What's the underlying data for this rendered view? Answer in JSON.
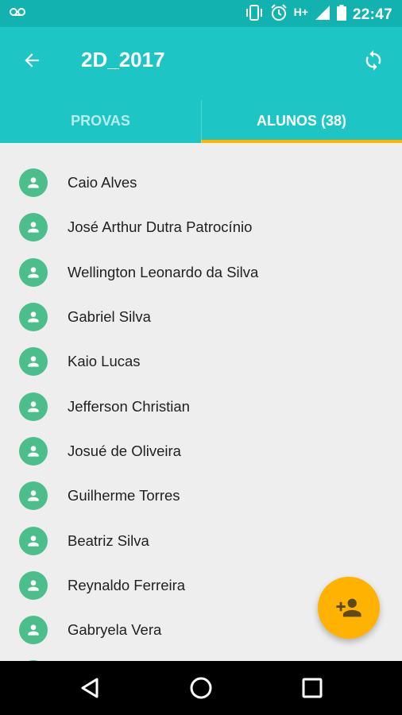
{
  "status_bar": {
    "time": "22:47",
    "network": "H+",
    "icons": [
      "voicemail-icon",
      "vibrate-icon",
      "alarm-icon",
      "signal-icon",
      "battery-icon"
    ]
  },
  "app_bar": {
    "title": "2D_2017",
    "back_icon": "arrow-back-icon",
    "sync_icon": "sync-icon"
  },
  "tabs": [
    {
      "label": "PROVAS",
      "active": false
    },
    {
      "label": "ALUNOS (38)",
      "active": true
    }
  ],
  "students": [
    {
      "name": "Caio Alves"
    },
    {
      "name": "José Arthur Dutra Patrocínio"
    },
    {
      "name": "Wellington Leonardo da Silva"
    },
    {
      "name": "Gabriel Silva"
    },
    {
      "name": "Kaio Lucas"
    },
    {
      "name": "Jefferson Christian"
    },
    {
      "name": "Josué de Oliveira"
    },
    {
      "name": "Guilherme Torres"
    },
    {
      "name": "Beatriz Silva"
    },
    {
      "name": "Reynaldo Ferreira"
    },
    {
      "name": "Gabryela Vera"
    }
  ],
  "fab": {
    "icon": "add-person-icon"
  },
  "nav_bar": {
    "icons": [
      "back-triangle-icon",
      "home-circle-icon",
      "recents-square-icon"
    ]
  },
  "colors": {
    "status_bar": "#12b2b0",
    "app_bar": "#1dc5c4",
    "tab_indicator": "#ffb300",
    "avatar": "#4cbe8b",
    "fab": "#ffb300",
    "background": "#eeeeee"
  }
}
